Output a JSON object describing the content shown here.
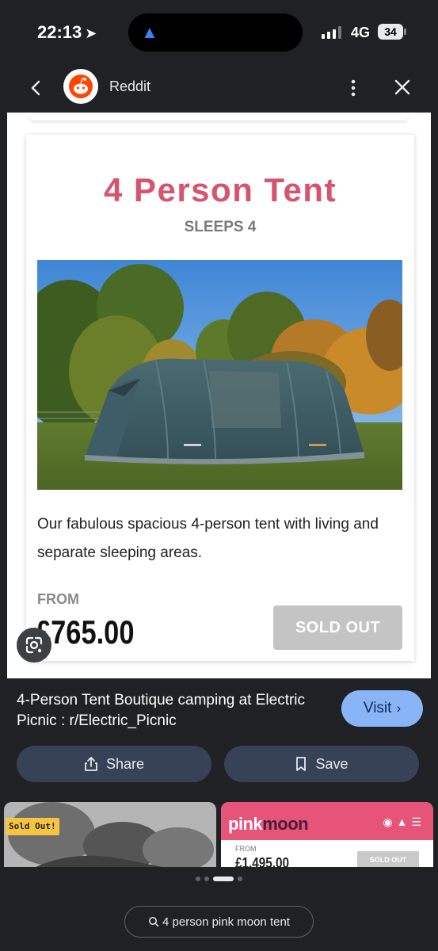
{
  "status_bar": {
    "time": "22:13",
    "network": "4G",
    "battery": "34"
  },
  "header": {
    "site_name": "Reddit"
  },
  "card": {
    "title": "4 Person Tent",
    "subtitle": "SLEEPS 4",
    "description": "Our fabulous spacious 4-person tent with living and separate sleeping areas.",
    "from_label": "FROM",
    "price": "£765.00",
    "sold_out_label": "SOLD OUT",
    "title_color": "#d6546e"
  },
  "info": {
    "title": "4-Person Tent Boutique camping at Electric Picnic : r/Electric_Picnic",
    "visit_label": "Visit",
    "share_label": "Share",
    "save_label": "Save"
  },
  "related": {
    "left_badge": "Sold Out!",
    "right_logo_pink": "pink",
    "right_logo_moon": "moon",
    "right_from": "FROM",
    "right_price": "£1,495.00",
    "right_sold_out": "SOLD OUT"
  },
  "search": {
    "query": "4 person pink moon tent"
  },
  "colors": {
    "accent": "#8ab4f8",
    "pill": "#374257",
    "brand_pink": "#e6547a"
  }
}
